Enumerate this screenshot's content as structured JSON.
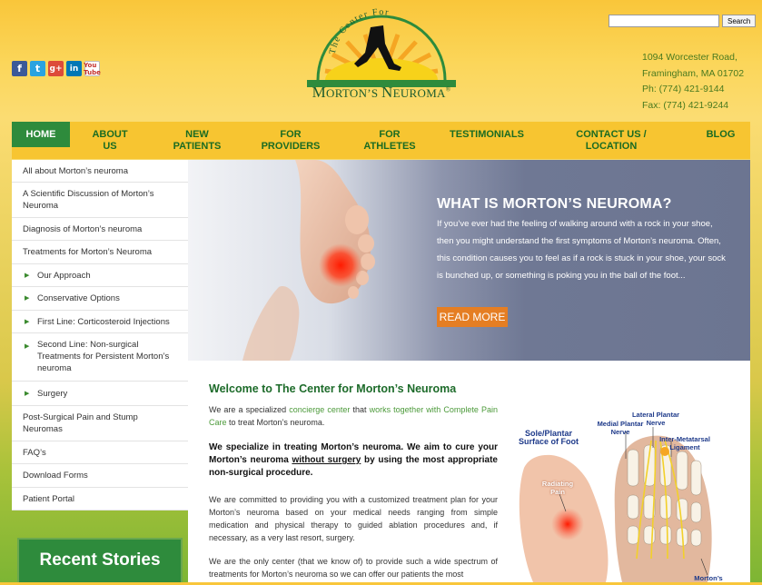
{
  "header": {
    "logo_top": "The Center For",
    "logo_main_first": "M",
    "logo_main_rest": "ORTON’S ",
    "logo_main_second": "N",
    "logo_main_end": "EUROMA",
    "logo_mark": "®",
    "search_placeholder": "",
    "search_button": "Search",
    "address": {
      "street": "1094 Worcester Road,",
      "city": "Framingham, MA 01702",
      "phone": "Ph: (774) 421-9144",
      "fax": "Fax: (774) 421-9244"
    },
    "social": {
      "facebook": "f",
      "twitter": "t",
      "googleplus": "g+",
      "linkedin": "in",
      "youtube": "You Tube"
    }
  },
  "nav": [
    {
      "label": "HOME",
      "active": true
    },
    {
      "label": "ABOUT\nUS"
    },
    {
      "label": "NEW\nPATIENTS"
    },
    {
      "label": "FOR\nPROVIDERS"
    },
    {
      "label": "FOR\nATHLETES"
    },
    {
      "label": "TESTIMONIALS"
    },
    {
      "label": "CONTACT US /\nLOCATION"
    },
    {
      "label": "BLOG"
    }
  ],
  "sidebar": {
    "items": [
      {
        "label": "All about Morton’s neuroma"
      },
      {
        "label": "A Scientific Discussion of Morton’s Neuroma"
      },
      {
        "label": "Diagnosis of Morton’s neuroma"
      },
      {
        "label": "Treatments for Morton’s Neuroma"
      },
      {
        "label": "Our Approach",
        "sub": true
      },
      {
        "label": "Conservative Options",
        "sub": true
      },
      {
        "label": "First Line: Corticosteroid Injections",
        "sub": true
      },
      {
        "label": "Second Line: Non-surgical Treatments for Persistent Morton’s neuroma",
        "sub": true
      },
      {
        "label": "Surgery",
        "sub": true
      },
      {
        "label": "Post-Surgical Pain and Stump Neuromas"
      },
      {
        "label": "FAQ’s"
      },
      {
        "label": "Download Forms"
      },
      {
        "label": "Patient Portal"
      }
    ],
    "recent_stories": "Recent Stories"
  },
  "hero": {
    "title": "WHAT IS MORTON’S NEUROMA?",
    "text": "If you’ve ever had the feeling of walking around with a rock in your shoe, then you might understand the first symptoms of Morton’s neuroma.  Often, this condition causes you to feel as if a rock is stuck in your shoe, your sock is bunched up, or something is poking you in the ball of the foot...",
    "button": "READ MORE"
  },
  "main": {
    "welcome": "Welcome to The Center for Morton’s Neuroma",
    "p1_a": "We are a specialized ",
    "p1_link1": "concierge center",
    "p1_b": " that ",
    "p1_link2": "works together with Complete Pain Care",
    "p1_c": " to treat  Morton’s neuroma.",
    "p2_a": "We specialize in treating Morton’s neuroma. We aim to cure your Morton’s neuroma ",
    "p2_u": "without surgery",
    "p2_b": " by using the most appropriate non-surgical procedure.",
    "p3": "We are committed to providing you with a customized treatment plan for your Morton’s neuroma based on your medical needs ranging from simple medication and physical therapy to guided ablation procedures and, if necessary, as a very last resort, surgery.",
    "p4": "We are the only center (that we know of) to provide such a wide spectrum of treatments for Morton’s neuroma so we can offer our patients the most",
    "diagram": {
      "sole": "Sole/Plantar\nSurface of Foot",
      "radiating": "Radiating\nPain",
      "medial": "Medial Plantar\nNerve",
      "lateral": "Lateral Plantar\nNerve",
      "inter": "Inter-Metatarsal\nLigament",
      "mortons": "Morton’s"
    }
  }
}
